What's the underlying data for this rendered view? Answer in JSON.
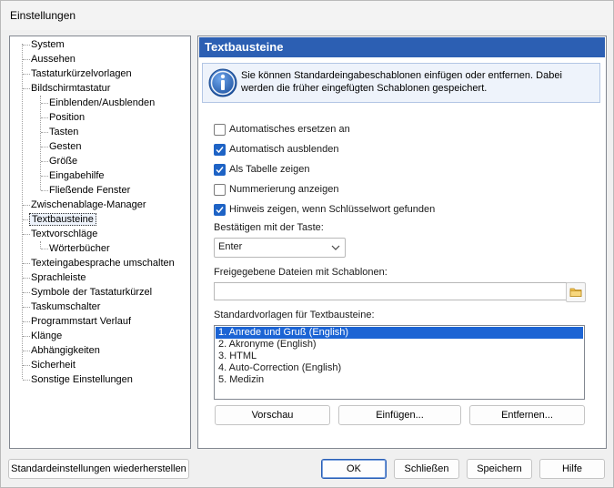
{
  "window": {
    "title": "Einstellungen"
  },
  "tree": {
    "items": [
      {
        "label": "System"
      },
      {
        "label": "Aussehen"
      },
      {
        "label": "Tastaturkürzelvorlagen"
      },
      {
        "label": "Bildschirmtastatur"
      },
      {
        "label": "Einblenden/Ausblenden"
      },
      {
        "label": "Position"
      },
      {
        "label": "Tasten"
      },
      {
        "label": "Gesten"
      },
      {
        "label": "Größe"
      },
      {
        "label": "Eingabehilfe"
      },
      {
        "label": "Fließende Fenster"
      },
      {
        "label": "Zwischenablage-Manager"
      },
      {
        "label": "Textbausteine"
      },
      {
        "label": "Textvorschläge"
      },
      {
        "label": "Wörterbücher"
      },
      {
        "label": "Texteingabesprache umschalten"
      },
      {
        "label": "Sprachleiste"
      },
      {
        "label": "Symbole der Tastaturkürzel"
      },
      {
        "label": "Taskumschalter"
      },
      {
        "label": "Programmstart Verlauf"
      },
      {
        "label": "Klänge"
      },
      {
        "label": "Abhängigkeiten"
      },
      {
        "label": "Sicherheit"
      },
      {
        "label": "Sonstige Einstellungen"
      }
    ],
    "selected": "Textbausteine"
  },
  "panel": {
    "header": "Textbausteine",
    "info_text": "Sie können Standardeingabeschablonen einfügen oder entfernen. Dabei werden die früher eingefügten Schablonen gespeichert.",
    "info_icon": "info-icon",
    "checkboxes": [
      {
        "label": "Automatisches ersetzen an",
        "checked": false
      },
      {
        "label": "Automatisch ausblenden",
        "checked": true
      },
      {
        "label": "Als Tabelle zeigen",
        "checked": true
      },
      {
        "label": "Nummerierung anzeigen",
        "checked": false
      },
      {
        "label": "Hinweis zeigen, wenn Schlüsselwort gefunden",
        "checked": true
      }
    ],
    "confirm_key_label": "Bestätigen mit der Taste:",
    "confirm_key_value": "Enter",
    "shared_files_label": "Freigegebene Dateien mit Schablonen:",
    "shared_files_value": "",
    "templates_label": "Standardvorlagen für Textbausteine:",
    "templates": [
      "1. Anrede und Gruß (English)",
      "2. Akronyme (English)",
      "3. HTML",
      "4. Auto-Correction (English)",
      "5. Medizin"
    ],
    "selected_template": "1. Anrede und Gruß (English)",
    "buttons": {
      "preview": "Vorschau",
      "insert": "Einfügen...",
      "remove": "Entfernen..."
    }
  },
  "footer": {
    "restore_defaults": "Standardeinstellungen wiederherstellen",
    "ok": "OK",
    "close": "Schließen",
    "save": "Speichern",
    "help": "Hilfe"
  },
  "colors": {
    "header_bg": "#2c5fb3",
    "selection_bg": "#1c64d4",
    "checkbox_checked": "#1e63c5",
    "info_bg": "#eef3fb"
  }
}
